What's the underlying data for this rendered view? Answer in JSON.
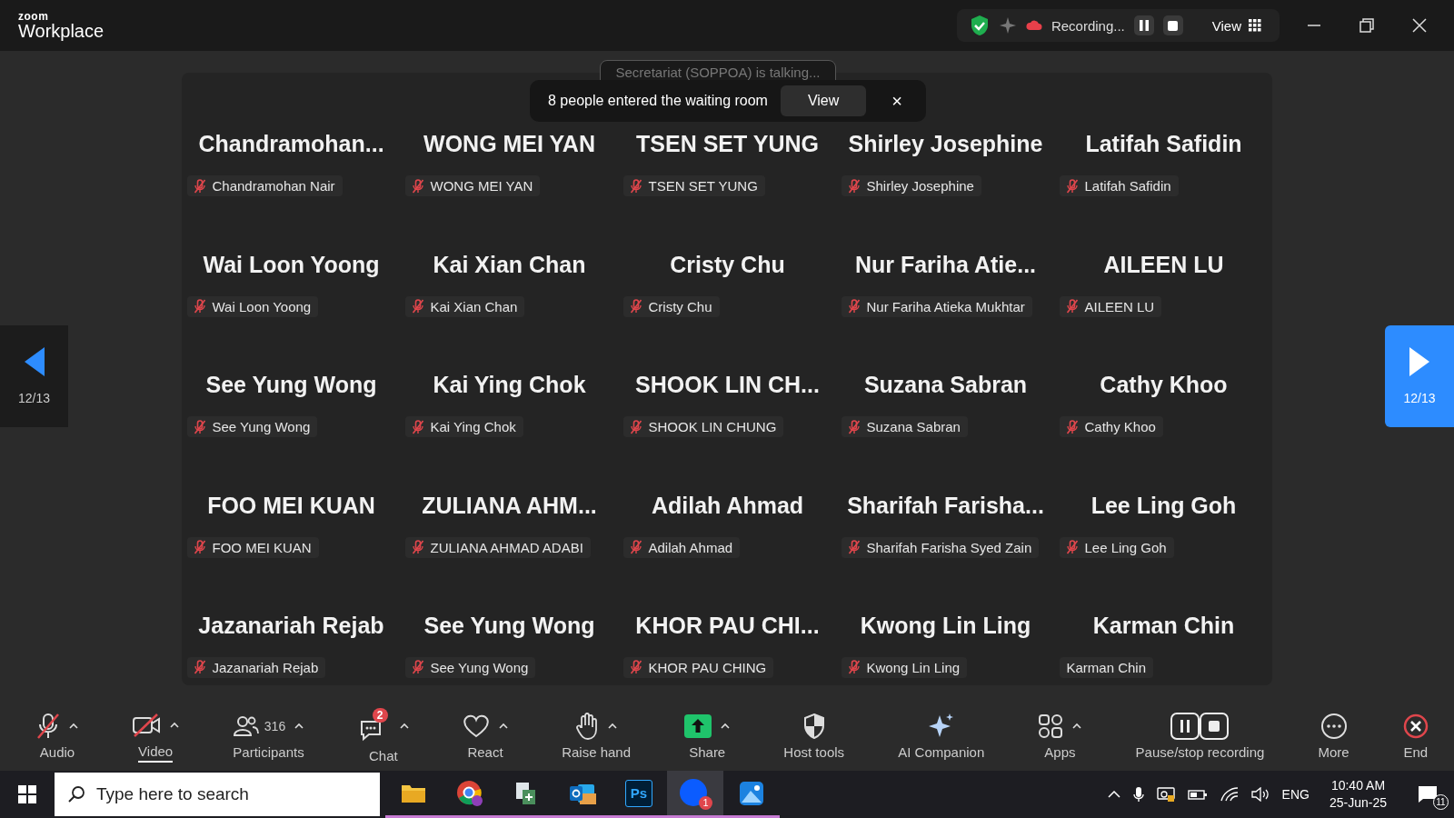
{
  "window": {
    "brand_top": "zoom",
    "brand": "Workplace",
    "recording_label": "Recording...",
    "view_label": "View"
  },
  "talking_toast": "Secretariat (SOPPOA) is talking...",
  "waiting_toast": {
    "message": "8 people entered the waiting room",
    "button": "View",
    "close": "×"
  },
  "pager": {
    "left": "12/13",
    "right": "12/13"
  },
  "tiles": [
    {
      "display": "Chandramohan...",
      "label": "Chandramohan Nair",
      "muted": true
    },
    {
      "display": "WONG MEI YAN",
      "label": "WONG MEI YAN",
      "muted": true
    },
    {
      "display": "TSEN SET YUNG",
      "label": "TSEN SET YUNG",
      "muted": true
    },
    {
      "display": "Shirley Josephine",
      "label": "Shirley Josephine",
      "muted": true
    },
    {
      "display": "Latifah Safidin",
      "label": "Latifah Safidin",
      "muted": true
    },
    {
      "display": "Wai Loon Yoong",
      "label": "Wai Loon Yoong",
      "muted": true
    },
    {
      "display": "Kai Xian Chan",
      "label": "Kai Xian Chan",
      "muted": true
    },
    {
      "display": "Cristy Chu",
      "label": "Cristy Chu",
      "muted": true
    },
    {
      "display": "Nur  Fariha  Atie...",
      "label": "Nur Fariha Atieka Mukhtar",
      "muted": true
    },
    {
      "display": "AILEEN LU",
      "label": "AILEEN LU",
      "muted": true
    },
    {
      "display": "See Yung Wong",
      "label": "See Yung Wong",
      "muted": true
    },
    {
      "display": "Kai Ying Chok",
      "label": "Kai Ying Chok",
      "muted": true
    },
    {
      "display": "SHOOK LIN CH...",
      "label": "SHOOK LIN CHUNG",
      "muted": true
    },
    {
      "display": "Suzana Sabran",
      "label": "Suzana Sabran",
      "muted": true
    },
    {
      "display": "Cathy Khoo",
      "label": "Cathy Khoo",
      "muted": true
    },
    {
      "display": "FOO MEI KUAN",
      "label": "FOO MEI KUAN",
      "muted": true
    },
    {
      "display": "ZULIANA  AHM...",
      "label": "ZULIANA AHMAD ADABI",
      "muted": true
    },
    {
      "display": "Adilah Ahmad",
      "label": "Adilah Ahmad",
      "muted": true
    },
    {
      "display": "Sharifah  Farisha...",
      "label": "Sharifah Farisha Syed Zain",
      "muted": true
    },
    {
      "display": "Lee Ling Goh",
      "label": "Lee Ling Goh",
      "muted": true
    },
    {
      "display": "Jazanariah Rejab",
      "label": "Jazanariah Rejab",
      "muted": true
    },
    {
      "display": "See Yung Wong",
      "label": "See Yung Wong",
      "muted": true
    },
    {
      "display": "KHOR PAU CHI...",
      "label": "KHOR PAU CHING",
      "muted": true
    },
    {
      "display": "Kwong Lin Ling",
      "label": "Kwong Lin Ling",
      "muted": true
    },
    {
      "display": "Karman Chin",
      "label": "Karman Chin",
      "muted": false
    }
  ],
  "toolbar": [
    {
      "kind": "audio",
      "label": "Audio",
      "caret": true
    },
    {
      "kind": "video",
      "label": "Video",
      "caret": true
    },
    {
      "kind": "participants",
      "label": "Participants",
      "count": "316",
      "caret": true
    },
    {
      "kind": "chat",
      "label": "Chat",
      "badge": "2",
      "caret": true
    },
    {
      "kind": "react",
      "label": "React",
      "caret": true
    },
    {
      "kind": "hand",
      "label": "Raise hand",
      "caret": true
    },
    {
      "kind": "share",
      "label": "Share",
      "caret": true
    },
    {
      "kind": "host",
      "label": "Host tools",
      "caret": false
    },
    {
      "kind": "ai",
      "label": "AI Companion",
      "caret": false
    },
    {
      "kind": "apps",
      "label": "Apps",
      "caret": true
    },
    {
      "kind": "record",
      "label": "Pause/stop recording",
      "caret": false
    },
    {
      "kind": "more",
      "label": "More",
      "caret": false
    },
    {
      "kind": "end",
      "label": "End",
      "caret": false
    }
  ],
  "taskbar": {
    "search_placeholder": "Type here to search",
    "apps": [
      {
        "kind": "folder"
      },
      {
        "kind": "chrome"
      },
      {
        "kind": "files"
      },
      {
        "kind": "outlook"
      },
      {
        "kind": "ps",
        "text": "Ps"
      },
      {
        "kind": "zoom",
        "badge": "1"
      },
      {
        "kind": "photos"
      }
    ],
    "language": "ENG",
    "time": "10:40 AM",
    "date": "25-Jun-25",
    "notifications": "11"
  }
}
